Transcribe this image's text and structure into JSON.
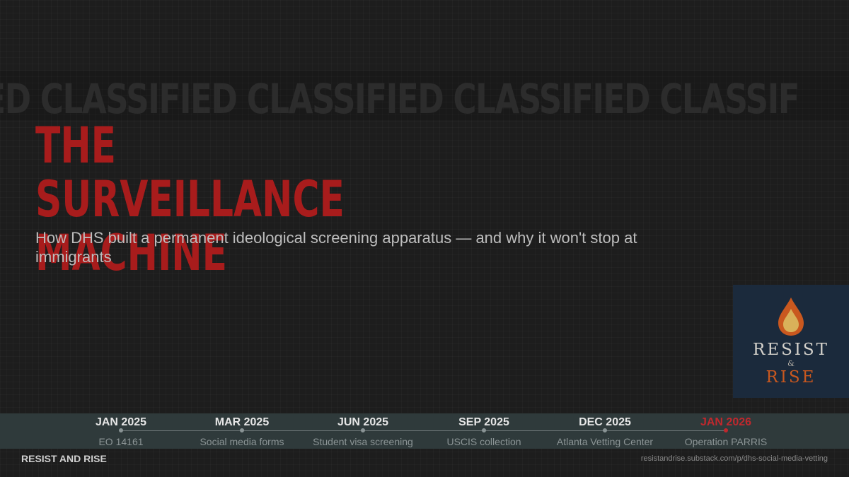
{
  "watermark": "IED CLASSIFIED CLASSIFIED CLASSIFIED CLASSIF",
  "title_line1": "THE SURVEILLANCE",
  "title_line2": "MACHINE",
  "subtitle": "How DHS built a permanent ideological screening apparatus — and why it won't stop at immigrants",
  "logo": {
    "resist": "RESIST",
    "amp": "&",
    "rise": "RISE",
    "icon": "flame-drop-icon"
  },
  "timeline": [
    {
      "date": "JAN 2025",
      "label": "EO 14161",
      "current": false
    },
    {
      "date": "MAR 2025",
      "label": "Social media forms",
      "current": false
    },
    {
      "date": "JUN 2025",
      "label": "Student visa screening",
      "current": false
    },
    {
      "date": "SEP 2025",
      "label": "USCIS collection",
      "current": false
    },
    {
      "date": "DEC 2025",
      "label": "Atlanta Vetting Center",
      "current": false
    },
    {
      "date": "JAN 2026",
      "label": "Operation PARRIS",
      "current": true
    }
  ],
  "footer": {
    "brand": "RESIST AND RISE",
    "url": "resistandrise.substack.com/p/dhs-social-media-vetting"
  },
  "colors": {
    "background": "#1d1d1d",
    "title_red": "#a81c1c",
    "highlight_red": "#c0282d",
    "timeline_bar": "#2f3a3b",
    "logo_navy": "#1b2a3c",
    "logo_orange": "#c9581f"
  }
}
